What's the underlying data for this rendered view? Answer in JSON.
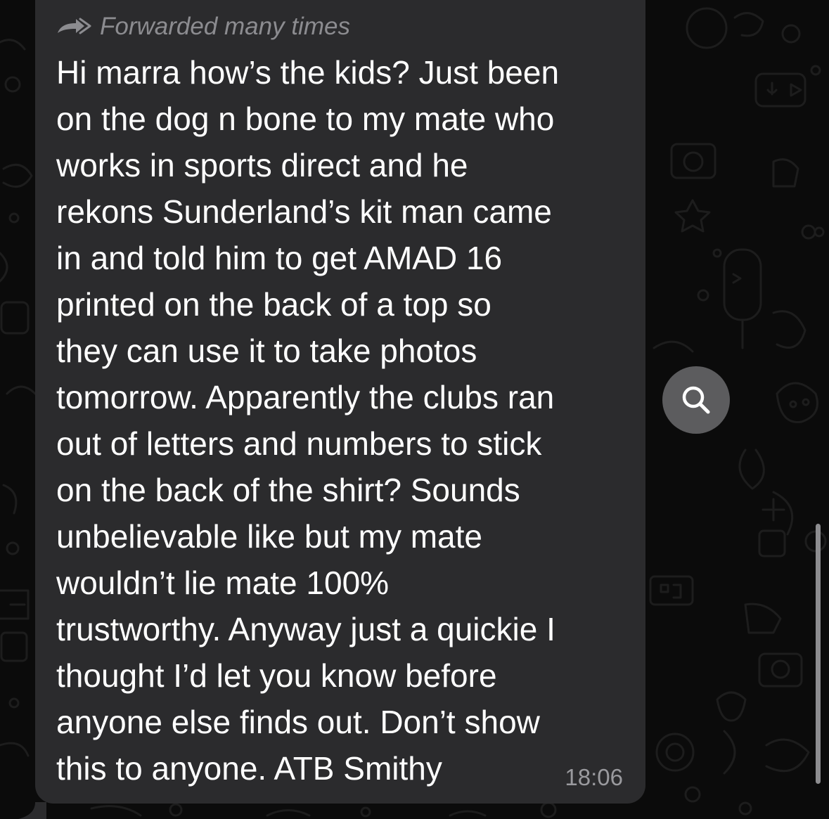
{
  "chat": {
    "forwarded_label": "Forwarded many times",
    "forwarded_icon": "forward-arrow-icon",
    "message_lines": [
      "Hi marra how’s the kids? Just been",
      "on the dog n bone to my mate who",
      "works in sports direct and he",
      "rekons Sunderland’s kit man came",
      "in and told him to get AMAD 16",
      "printed on the back of a top so",
      "they can use it to take photos",
      "tomorrow. Apparently the clubs ran",
      "out of letters and numbers to stick",
      "on the back of the shirt? Sounds",
      "unbelievable like but my mate",
      "wouldn’t lie mate 100%",
      "trustworthy. Anyway just a quickie I",
      "thought I’d let you know before",
      "anyone else finds out. Don’t show",
      "this to anyone. ATB Smithy"
    ],
    "timestamp": "18:06"
  },
  "actions": {
    "search_icon": "search-icon"
  },
  "colors": {
    "background": "#0b0b0b",
    "bubble": "#2b2b2d",
    "message_text": "#ffffff",
    "forwarded_text": "#8c8c90",
    "timestamp_text": "#9a9a9e",
    "search_button": "#5c5c5e",
    "scrollbar": "#8d8d90"
  }
}
